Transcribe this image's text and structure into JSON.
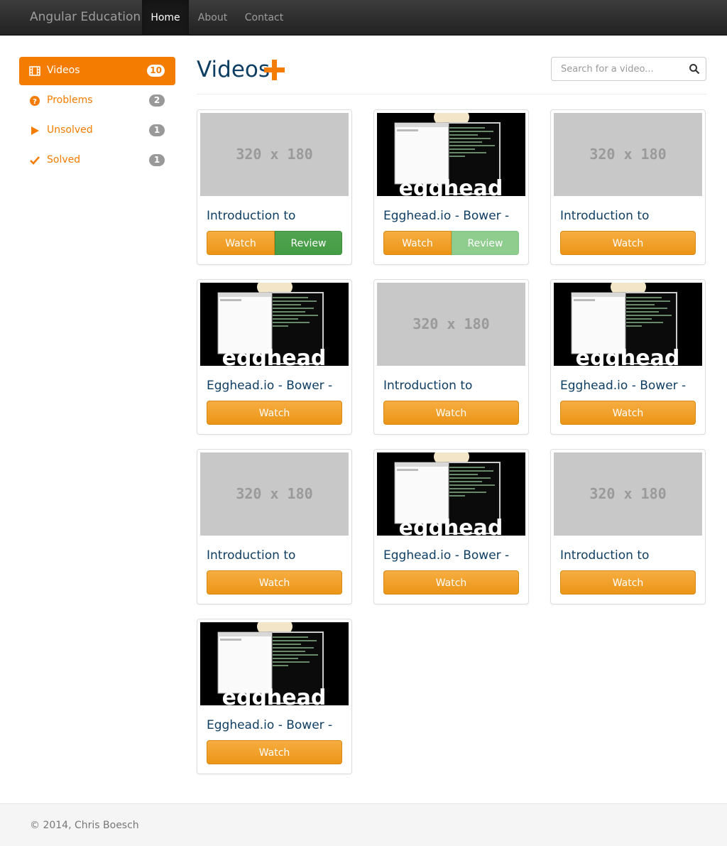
{
  "navbar": {
    "brand": "Angular Education",
    "items": [
      {
        "label": "Home",
        "active": true
      },
      {
        "label": "About",
        "active": false
      },
      {
        "label": "Contact",
        "active": false
      }
    ]
  },
  "sidebar": {
    "items": [
      {
        "label": "Videos",
        "count": "10",
        "icon": "film-icon",
        "active": true
      },
      {
        "label": "Problems",
        "count": "2",
        "icon": "question-circle-icon",
        "active": false
      },
      {
        "label": "Unsolved",
        "count": "1",
        "icon": "play-icon",
        "active": false
      },
      {
        "label": "Solved",
        "count": "1",
        "icon": "check-icon",
        "active": false
      }
    ]
  },
  "header": {
    "title": "Videos",
    "add_icon": "plus-icon",
    "accent_color": "#f47c00"
  },
  "search": {
    "placeholder": "Search for a video...",
    "icon": "search-icon"
  },
  "cards": [
    {
      "title": "Introduction to",
      "thumb": "placeholder",
      "thumb_text": "320 x 180",
      "watch": "Watch",
      "review": "Review",
      "review_state": "active"
    },
    {
      "title": "Egghead.io - Bower -",
      "thumb": "egghead",
      "watch": "Watch",
      "review": "Review",
      "review_state": "faded"
    },
    {
      "title": "Introduction to",
      "thumb": "placeholder",
      "thumb_text": "320 x 180",
      "watch": "Watch"
    },
    {
      "title": "Egghead.io - Bower -",
      "thumb": "egghead",
      "watch": "Watch"
    },
    {
      "title": "Introduction to",
      "thumb": "placeholder",
      "thumb_text": "320 x 180",
      "watch": "Watch"
    },
    {
      "title": "Egghead.io - Bower -",
      "thumb": "egghead",
      "watch": "Watch"
    },
    {
      "title": "Introduction to",
      "thumb": "placeholder",
      "thumb_text": "320 x 180",
      "watch": "Watch"
    },
    {
      "title": "Egghead.io - Bower -",
      "thumb": "egghead",
      "watch": "Watch"
    },
    {
      "title": "Introduction to",
      "thumb": "placeholder",
      "thumb_text": "320 x 180",
      "watch": "Watch"
    },
    {
      "title": "Egghead.io - Bower -",
      "thumb": "egghead",
      "watch": "Watch"
    }
  ],
  "egghead_logo_text": "egghead",
  "footer": {
    "text": "© 2014, Chris Boesch"
  }
}
